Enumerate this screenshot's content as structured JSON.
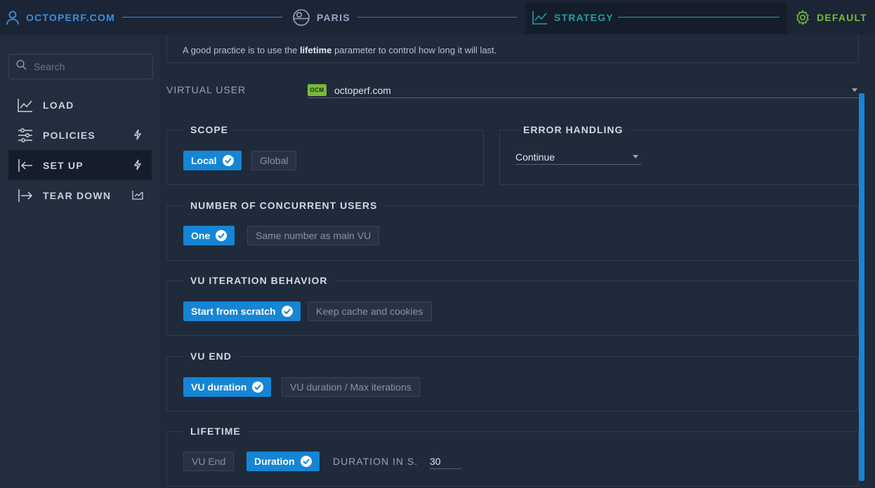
{
  "stepper": {
    "steps": [
      {
        "label": "OCTOPERF.COM",
        "icon": "user-icon",
        "color": "#3b8fe4"
      },
      {
        "label": "PARIS",
        "icon": "globe-icon",
        "color": "#9aa9c9"
      },
      {
        "label": "STRATEGY",
        "icon": "chart-line-icon",
        "color": "#1fa0a8"
      },
      {
        "label": "DEFAULT",
        "icon": "gear-icon",
        "color": "#6fbf3a"
      }
    ]
  },
  "sidebar": {
    "search_placeholder": "Search",
    "items": [
      {
        "label": "LOAD",
        "icon": "chart-line-icon"
      },
      {
        "label": "POLICIES",
        "icon": "sliders-icon",
        "right_icon": "bolt-icon"
      },
      {
        "label": "SET UP",
        "icon": "arrow-left-bar-icon",
        "right_icon": "bolt-icon",
        "active": true
      },
      {
        "label": "TEAR DOWN",
        "icon": "arrow-right-bar-icon",
        "right_icon": "chart-box-icon"
      }
    ]
  },
  "main": {
    "info_prefix": "A good practice is to use the ",
    "info_bold": "lifetime",
    "info_suffix": " parameter to control how long it will last.",
    "virtual_user": {
      "label": "VIRTUAL USER",
      "badge": "OCM",
      "value": "octoperf.com"
    },
    "scope": {
      "title": "SCOPE",
      "options": [
        "Local",
        "Global"
      ],
      "selected": "Local"
    },
    "error_handling": {
      "title": "ERROR HANDLING",
      "value": "Continue"
    },
    "concurrent_users": {
      "title": "NUMBER OF CONCURRENT USERS",
      "options": [
        "One",
        "Same number as main VU"
      ],
      "selected": "One"
    },
    "iteration": {
      "title": "VU ITERATION BEHAVIOR",
      "options": [
        "Start from scratch",
        "Keep cache and cookies"
      ],
      "selected": "Start from scratch"
    },
    "vu_end": {
      "title": "VU END",
      "options": [
        "VU duration",
        "VU duration / Max iterations"
      ],
      "selected": "VU duration"
    },
    "lifetime": {
      "title": "LIFETIME",
      "options": [
        "VU End",
        "Duration"
      ],
      "selected": "Duration",
      "duration_label": "DURATION IN S.",
      "duration_value": "30"
    }
  }
}
